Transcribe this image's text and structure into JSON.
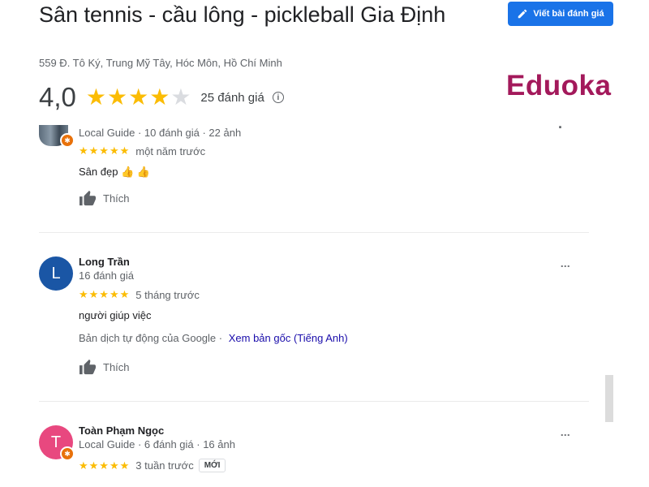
{
  "place": {
    "title": "Sân tennis - cầu lông - pickleball Gia Định",
    "address": "559 Đ. Tô Ký, Trung Mỹ Tây, Hóc Môn, Hồ Chí Minh",
    "rating": "4,0",
    "stars": 4,
    "review_count": "25 đánh giá",
    "info_icon": "info-icon"
  },
  "header": {
    "write_review_label": "Viết bài đánh giá",
    "logo_text": "Eduoka"
  },
  "reviews": [
    {
      "name": "",
      "meta": "Local Guide · 10 đánh giá · 22 ảnh",
      "stars": 5,
      "time": "một năm trước",
      "text": "Sân đẹp 👍 👍",
      "like_label": "Thích"
    },
    {
      "name": "Long Trần",
      "avatar_letter": "L",
      "meta": "16 đánh giá",
      "stars": 5,
      "time": "5 tháng trước",
      "text": "người giúp việc",
      "translation_note": "Bản dịch tự động của Google",
      "translation_link": "Xem bản gốc (Tiếng Anh)",
      "like_label": "Thích"
    },
    {
      "name": "Toàn Phạm Ngọc",
      "avatar_letter": "T",
      "meta": "Local Guide · 6 đánh giá · 16 ảnh",
      "stars": 5,
      "time": "3 tuần trước",
      "new_tag": "MỚI"
    }
  ],
  "stars_glyph": "★★★★★",
  "colors": {
    "accent": "#1a73e8",
    "star": "#fbbc04",
    "logo": "#a3195b",
    "avatar_long": "#1a56a5",
    "avatar_toan": "#e8487f",
    "local_guide_badge": "#e8710a"
  }
}
